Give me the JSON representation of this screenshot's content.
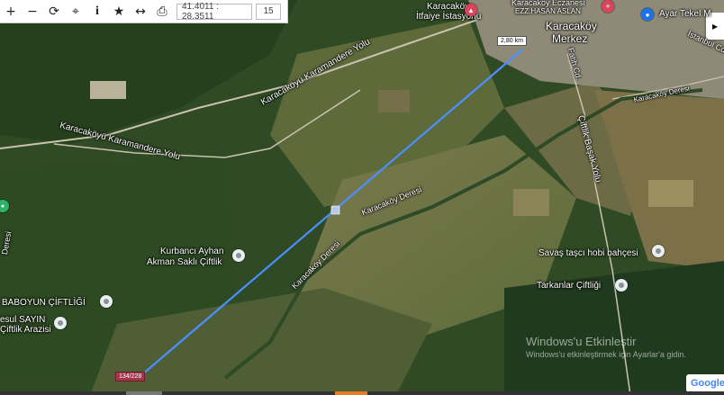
{
  "toolbar": {
    "buttons": [
      {
        "name": "zoom-in-button",
        "glyph": "+"
      },
      {
        "name": "zoom-out-button",
        "glyph": "−"
      },
      {
        "name": "refresh-button",
        "glyph": "⟳"
      },
      {
        "name": "locate-button",
        "glyph": "⌖"
      },
      {
        "name": "info-button",
        "glyph": "i"
      },
      {
        "name": "favorite-button",
        "glyph": "★"
      },
      {
        "name": "measure-button",
        "glyph": "↔"
      },
      {
        "name": "print-button",
        "glyph": "⎙"
      }
    ],
    "coordinates": "41.4011 : 28.3511",
    "zoom_level": "15"
  },
  "map": {
    "labels": {
      "karacakoy_itfaiye": "Karacaköy",
      "itfaiye_istasyonu": "İtfaiye İstasyonu",
      "karacakoy_eczanesi": "Karacaköy Eczanesi",
      "ezz_hasan": "EZZ.HASAN ASLAN",
      "karacakoy_merkez_1": "Karacaköy",
      "karacakoy_merkez_2": "Merkez",
      "ayar_tekel": "Ayar Tekel M",
      "istanbul_cd": "İstanbul Cd.",
      "fatih_cd": "Fatih Cd.",
      "karacakoy_deresi_ne": "Karacaköy Deresi",
      "karamandere_yolu_upper": "Karacaköyü Karamandere Yolu",
      "karamandere_yolu_lower": "Karacaköyü Karamandere Yolu",
      "ciftlik_basak": "Çiftlik Başak Yolu",
      "karacakoy_deresi_mid": "Karacaköy Deresi",
      "karacakoy_deresi_low": "Karacaköy Deresi",
      "kurbanci_1": "Kurbancı Ayhan",
      "kurbanci_2": "Akman Saklı Çiftlik",
      "savas": "Savaş taşcı hobi bahçesi",
      "tarkanlar": "Tarkanlar Çiftliği",
      "baboyun": "BABOYUN ÇİFTLİĞİ",
      "resul_1": "esul SAYIN",
      "resul_2": "Çiftlik Arazisi",
      "deresi_left": "Deresi"
    },
    "measure_line": {
      "distance_label": "2,80 km",
      "parcel_label": "134/228"
    },
    "colors": {
      "measure_line": "#4a90ff",
      "marker_red": "#d9455a",
      "marker_blue": "#1a73e8",
      "poi_grey": "#8a9299",
      "poi_green": "#2fb36a"
    }
  },
  "watermark": {
    "line1": "Windows'u Etkinleştir",
    "line2": "Windows'u etkinleştirmek için Ayarlar'a gidin."
  },
  "attribution": "Google"
}
